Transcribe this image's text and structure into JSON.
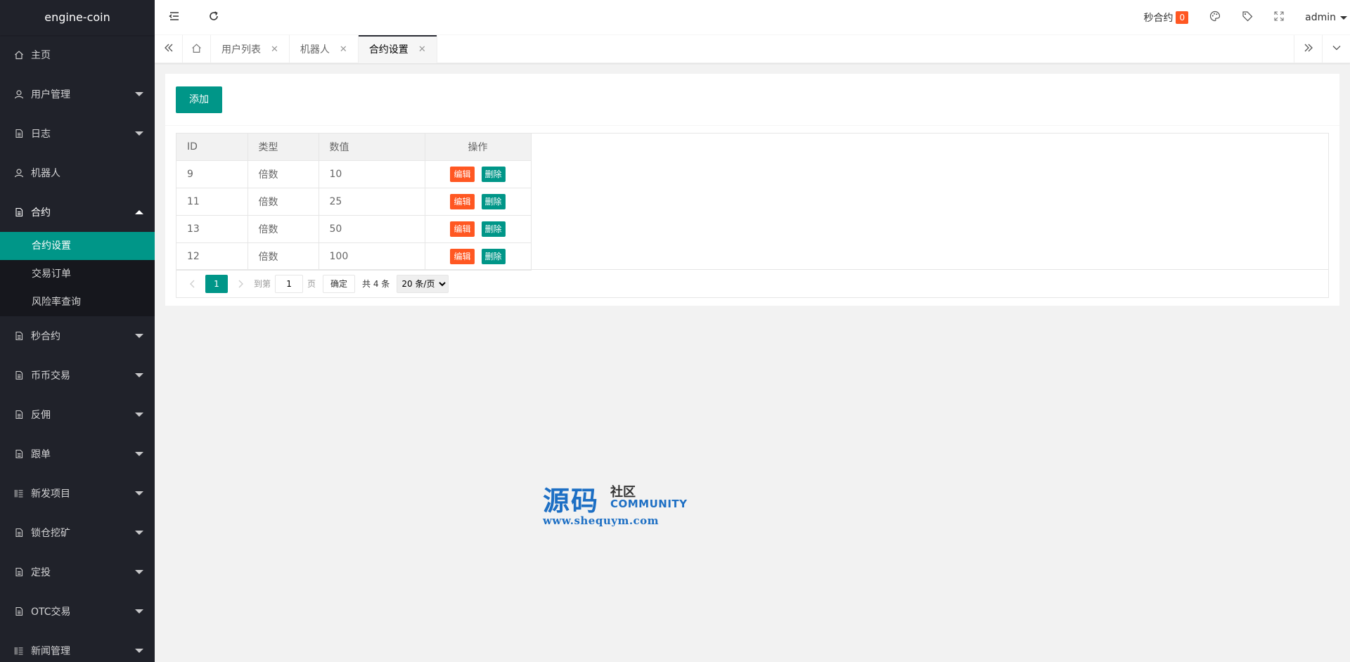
{
  "app": {
    "title": "engine-coin"
  },
  "sidebar": {
    "items": [
      {
        "label": "主页",
        "icon": "home-icon",
        "expandable": false
      },
      {
        "label": "用户管理",
        "icon": "user-icon",
        "expandable": true
      },
      {
        "label": "日志",
        "icon": "file-icon",
        "expandable": true
      },
      {
        "label": "机器人",
        "icon": "user-icon",
        "expandable": false
      },
      {
        "label": "合约",
        "icon": "file-icon",
        "expandable": true,
        "expanded": true,
        "children": [
          {
            "label": "合约设置",
            "active": true
          },
          {
            "label": "交易订单"
          },
          {
            "label": "风险率查询"
          }
        ]
      },
      {
        "label": "秒合约",
        "icon": "file-icon",
        "expandable": true
      },
      {
        "label": "币币交易",
        "icon": "file-icon",
        "expandable": true
      },
      {
        "label": "反佣",
        "icon": "file-icon",
        "expandable": true
      },
      {
        "label": "跟单",
        "icon": "file-icon",
        "expandable": true
      },
      {
        "label": "新发项目",
        "icon": "list-icon",
        "expandable": true
      },
      {
        "label": "锁仓挖矿",
        "icon": "file-icon",
        "expandable": true
      },
      {
        "label": "定投",
        "icon": "file-icon",
        "expandable": true
      },
      {
        "label": "OTC交易",
        "icon": "file-icon",
        "expandable": true
      },
      {
        "label": "新闻管理",
        "icon": "list-icon",
        "expandable": true
      }
    ]
  },
  "header": {
    "seconds_contract_label": "秒合约",
    "seconds_contract_count": "0",
    "user": "admin"
  },
  "tabs": [
    {
      "label": "用户列表",
      "active": false
    },
    {
      "label": "机器人",
      "active": false
    },
    {
      "label": "合约设置",
      "active": true
    }
  ],
  "toolbar": {
    "add_label": "添加"
  },
  "table": {
    "headers": [
      "ID",
      "类型",
      "数值",
      "操作"
    ],
    "rows": [
      {
        "id": "9",
        "type": "倍数",
        "value": "10"
      },
      {
        "id": "11",
        "type": "倍数",
        "value": "25"
      },
      {
        "id": "13",
        "type": "倍数",
        "value": "50"
      },
      {
        "id": "12",
        "type": "倍数",
        "value": "100"
      }
    ],
    "edit_label": "编辑",
    "delete_label": "删除"
  },
  "pager": {
    "current_page": "1",
    "goto_label": "到第",
    "goto_value": "1",
    "page_unit": "页",
    "confirm_label": "确定",
    "total_label": "共 4 条",
    "page_size": "20 条/页"
  },
  "watermark": {
    "big": "源码",
    "small_cn": "社区",
    "small_en": "COMMUNITY",
    "url": "www.shequym.com"
  },
  "colors": {
    "accent": "#009688",
    "danger": "#ff5722",
    "sidebar_bg": "#20222a"
  }
}
